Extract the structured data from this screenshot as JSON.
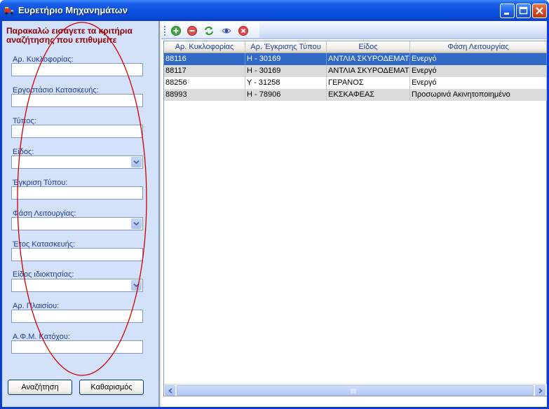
{
  "window": {
    "title": "Ευρετήριο Μηχανημάτων"
  },
  "search_panel": {
    "prompt": "Παρακαλώ εισάγετε τα κριτήρια αναζήτησης που επιθυμείτε",
    "fields": [
      {
        "label": "Αρ. Κυκλοφορίας:",
        "kind": "text",
        "value": ""
      },
      {
        "label": "Εργοστάσιο Κατασκευής:",
        "kind": "text",
        "value": ""
      },
      {
        "label": "Τύπος:",
        "kind": "text",
        "value": ""
      },
      {
        "label": "Είδος:",
        "kind": "select",
        "value": ""
      },
      {
        "label": "Έγκριση Τύπου:",
        "kind": "text",
        "value": ""
      },
      {
        "label": "Φάση Λειτουργίας:",
        "kind": "select",
        "value": ""
      },
      {
        "label": "Έτος Κατασκευής:",
        "kind": "text",
        "value": ""
      },
      {
        "label": "Είδος ιδιοκτησίας:",
        "kind": "select",
        "value": ""
      },
      {
        "label": "Αρ. Πλαισίου:",
        "kind": "text",
        "value": ""
      },
      {
        "label": "Α.Φ.Μ. Κατόχου:",
        "kind": "text",
        "value": ""
      }
    ],
    "search_button": "Αναζήτηση",
    "clear_button": "Καθαρισμός"
  },
  "toolbar": {
    "buttons": [
      "add-icon",
      "remove-icon",
      "refresh-icon",
      "view-icon",
      "close-icon"
    ]
  },
  "grid": {
    "columns": [
      "Αρ. Κυκλοφορίας",
      "Αρ. Έγκρισης Τύπου",
      "Είδος",
      "Φάση Λειτουργίας"
    ],
    "rows": [
      [
        "88116",
        "Η - 30169",
        "ΑΝΤΛΙΑ ΣΚΥΡΟΔΕΜΑΤΟΣ",
        "Ενεργό"
      ],
      [
        "88117",
        "Η - 30169",
        "ΑΝΤΛΙΑ ΣΚΥΡΟΔΕΜΑΤΟΣ",
        "Ενεργό"
      ],
      [
        "88256",
        "Υ - 31258",
        "ΓΕΡΑΝΟΣ",
        "Ενεργό"
      ],
      [
        "88993",
        "Η - 78906",
        "ΕΚΣΚΑΦΕΑΣ",
        "Προσωρινά Ακινητοποιημένο"
      ]
    ],
    "selected_row": 0
  },
  "colors": {
    "titlebar": "#0a50e0",
    "prompt_text": "#8b0000",
    "label_text": "#1f3f8f",
    "selection": "#3169c6",
    "annotation_oval": "#cc0000"
  }
}
